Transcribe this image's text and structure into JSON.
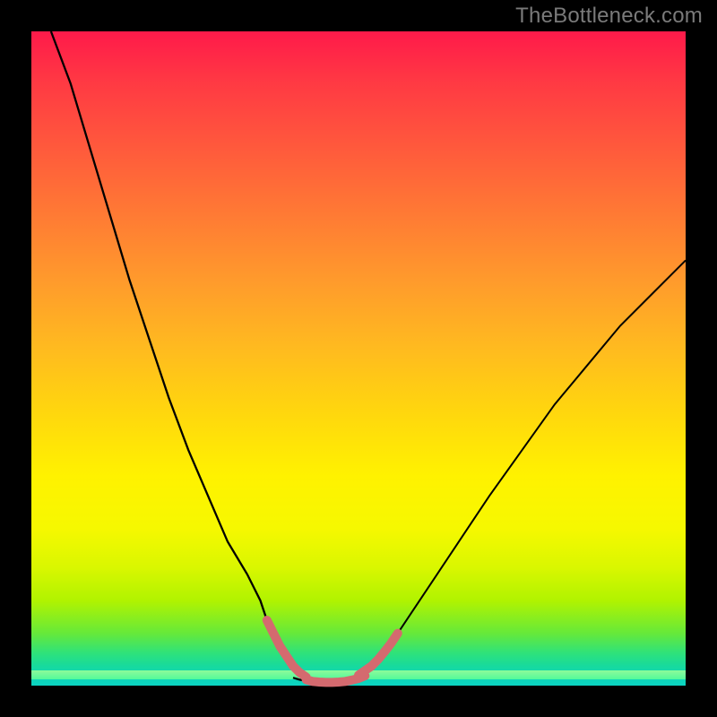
{
  "watermark": "TheBottleneck.com",
  "colors": {
    "page_bg": "#000000",
    "watermark": "#7a7a7a",
    "curve": "#000000",
    "highlight": "#d46a6f",
    "gradient_top": "#ff1a4a",
    "gradient_bottom": "#0bd3c2"
  },
  "chart_data": {
    "type": "line",
    "title": "",
    "xlabel": "",
    "ylabel": "",
    "xlim": [
      0,
      100
    ],
    "ylim": [
      0,
      100
    ],
    "grid": false,
    "legend": false,
    "annotations": [],
    "background": "vertical-gradient red→orange→yellow→green (top→bottom)",
    "series": [
      {
        "name": "left-arm",
        "x": [
          3,
          6,
          9,
          12,
          15,
          18,
          21,
          24,
          27,
          30,
          33,
          35,
          36,
          37,
          38,
          39,
          40,
          41,
          42,
          43
        ],
        "y": [
          100,
          92,
          82,
          72,
          62,
          53,
          44,
          36,
          29,
          22,
          17,
          13,
          10,
          8,
          6,
          4.5,
          3,
          2,
          1.3,
          0.8
        ]
      },
      {
        "name": "valley-floor",
        "x": [
          40,
          41,
          42,
          43,
          44,
          45,
          46,
          47,
          48,
          49,
          50
        ],
        "y": [
          1.2,
          0.9,
          0.7,
          0.55,
          0.5,
          0.5,
          0.55,
          0.7,
          0.9,
          1.2,
          1.6
        ]
      },
      {
        "name": "right-arm",
        "x": [
          50,
          52,
          55,
          58,
          62,
          66,
          70,
          75,
          80,
          85,
          90,
          95,
          100
        ],
        "y": [
          1.6,
          3,
          6.5,
          11,
          17,
          23,
          29,
          36,
          43,
          49,
          55,
          60,
          65
        ]
      },
      {
        "name": "highlight-segment-left",
        "x": [
          36,
          37,
          38,
          39,
          40,
          41,
          42
        ],
        "y": [
          10,
          8,
          6,
          4.5,
          3,
          2,
          1.3
        ]
      },
      {
        "name": "highlight-segment-floor",
        "x": [
          42,
          43,
          44,
          45,
          46,
          47,
          48,
          49,
          50,
          51
        ],
        "y": [
          0.9,
          0.65,
          0.55,
          0.5,
          0.5,
          0.55,
          0.65,
          0.85,
          1.1,
          1.5
        ]
      },
      {
        "name": "highlight-segment-right",
        "x": [
          50,
          51,
          52,
          53,
          54,
          55,
          56
        ],
        "y": [
          1.6,
          2.3,
          3,
          4,
          5.2,
          6.5,
          8
        ]
      }
    ]
  }
}
